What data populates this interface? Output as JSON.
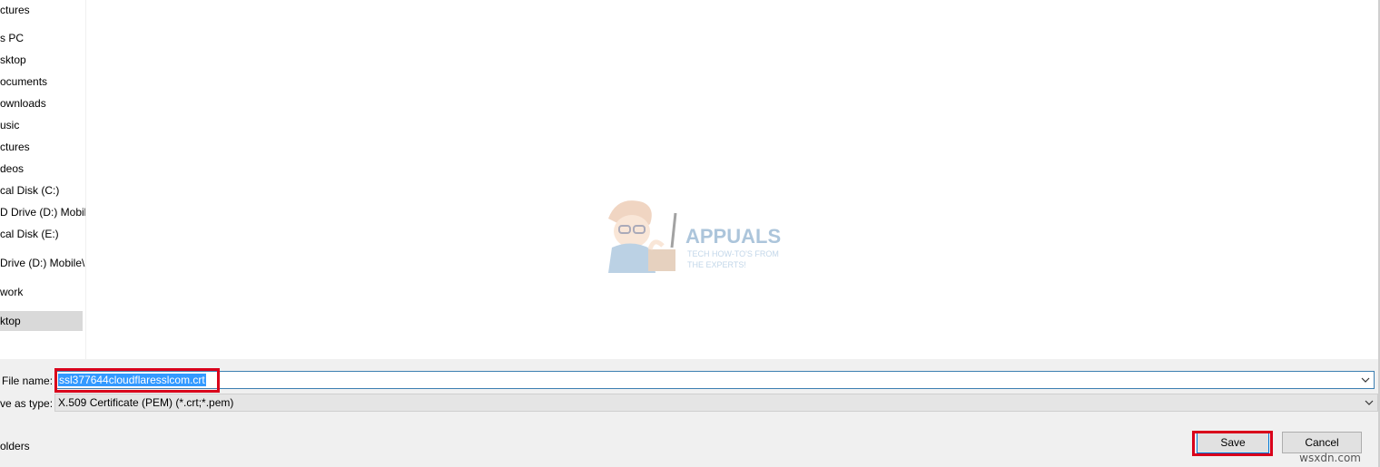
{
  "sidebar": {
    "items": [
      {
        "label": "ctures"
      },
      {
        "label": "s PC"
      },
      {
        "label": "sktop"
      },
      {
        "label": "ocuments"
      },
      {
        "label": "ownloads"
      },
      {
        "label": "usic"
      },
      {
        "label": "ctures"
      },
      {
        "label": "deos"
      },
      {
        "label": "cal Disk (C:)"
      },
      {
        "label": "D Drive (D:) Mobil"
      },
      {
        "label": "cal Disk (E:)"
      },
      {
        "label": "Drive (D:) Mobile\\"
      },
      {
        "label": "work"
      },
      {
        "label": "ktop"
      }
    ]
  },
  "form": {
    "file_name_label": "File name:",
    "file_name_value": "ssl377644cloudflaresslcom.crt",
    "save_type_label": "ve as type:",
    "save_type_value": "X.509 Certificate (PEM) (*.crt;*.pem)"
  },
  "footer": {
    "folders_toggle": "olders",
    "save_label": "Save",
    "cancel_label": "Cancel"
  },
  "watermark": {
    "brand": "APPUALS",
    "tagline_1": "TECH HOW-TO'S FROM",
    "tagline_2": "THE EXPERTS!"
  },
  "site_mark": "wsxdn.com",
  "icons": [
    "chevron-down-icon",
    "chevron-down-icon"
  ],
  "colors": {
    "selection": "#3399ff",
    "highlight_box": "#d9001b",
    "field_focus": "#3c7fb1",
    "panel_bg": "#f0f0f0"
  }
}
